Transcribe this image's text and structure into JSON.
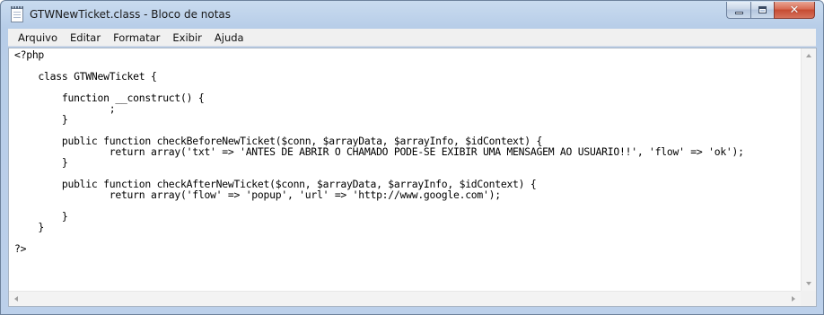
{
  "window": {
    "title": "GTWNewTicket.class - Bloco de notas"
  },
  "caption_buttons": {
    "close_glyph": "✕"
  },
  "icons": {
    "app": "notepad-icon",
    "minimize": "minimize-icon",
    "maximize": "maximize-icon",
    "close": "close-icon"
  },
  "menu": {
    "items": [
      "Arquivo",
      "Editar",
      "Formatar",
      "Exibir",
      "Ajuda"
    ]
  },
  "editor": {
    "lines": [
      "<?php",
      "",
      "    class GTWNewTicket {",
      "",
      "        function __construct() {",
      "                ;",
      "        }",
      "",
      "        public function checkBeforeNewTicket($conn, $arrayData, $arrayInfo, $idContext) {",
      "                return array('txt' => 'ANTES DE ABRIR O CHAMADO PODE-SE EXIBIR UMA MENSAGEM AO USUARIO!!', 'flow' => 'ok');",
      "        }",
      "",
      "        public function checkAfterNewTicket($conn, $arrayData, $arrayInfo, $idContext) {",
      "                return array('flow' => 'popup', 'url' => 'http://www.google.com');",
      "",
      "        }",
      "    }",
      "",
      "?>"
    ]
  }
}
